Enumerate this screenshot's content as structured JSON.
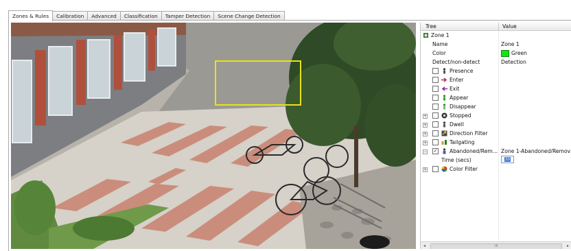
{
  "tabs": [
    {
      "label": "Zones & Rules",
      "active": true
    },
    {
      "label": "Calibration",
      "active": false
    },
    {
      "label": "Advanced",
      "active": false
    },
    {
      "label": "Classification",
      "active": false
    },
    {
      "label": "Tamper Detection",
      "active": false
    },
    {
      "label": "Scene Change Detection",
      "active": false
    }
  ],
  "camera_view": {
    "zone_outline_color": "#e8e31a"
  },
  "property_grid": {
    "header": {
      "tree": "Tree",
      "value": "Value"
    },
    "zone": {
      "label": "Zone 1",
      "icon": "zone-icon"
    },
    "name": {
      "label": "Name",
      "value": "Zone 1"
    },
    "color": {
      "label": "Color",
      "value": "Green",
      "swatch": "#19e019"
    },
    "detect": {
      "label": "Detect/non-detect",
      "value": "Detection"
    },
    "rules": [
      {
        "label": "Presence",
        "icon": "person-icon",
        "checked": false,
        "expandable": false
      },
      {
        "label": "Enter",
        "icon": "enter-arrow-icon",
        "checked": false,
        "expandable": false
      },
      {
        "label": "Exit",
        "icon": "exit-arrow-icon",
        "checked": false,
        "expandable": false
      },
      {
        "label": "Appear",
        "icon": "appear-icon",
        "checked": false,
        "expandable": false
      },
      {
        "label": "Disappear",
        "icon": "disappear-icon",
        "checked": false,
        "expandable": false
      },
      {
        "label": "Stopped",
        "icon": "stopped-icon",
        "checked": false,
        "expandable": true
      },
      {
        "label": "Dwell",
        "icon": "dwell-icon",
        "checked": false,
        "expandable": true
      },
      {
        "label": "Direction Filter",
        "icon": "direction-filter-icon",
        "checked": false,
        "expandable": true
      },
      {
        "label": "Tailgating",
        "icon": "tailgating-icon",
        "checked": false,
        "expandable": true
      },
      {
        "label": "Abandoned/Rem...",
        "icon": "abandoned-object-icon",
        "checked": true,
        "expandable": true,
        "expanded": true,
        "value": "Zone 1-Abandoned/Remov"
      }
    ],
    "time": {
      "label": "Time (secs)",
      "value": "30"
    },
    "color_filter": {
      "label": "Color Filter",
      "icon": "color-filter-icon",
      "checked": false
    },
    "scrollbar": {
      "grip": "III"
    }
  }
}
